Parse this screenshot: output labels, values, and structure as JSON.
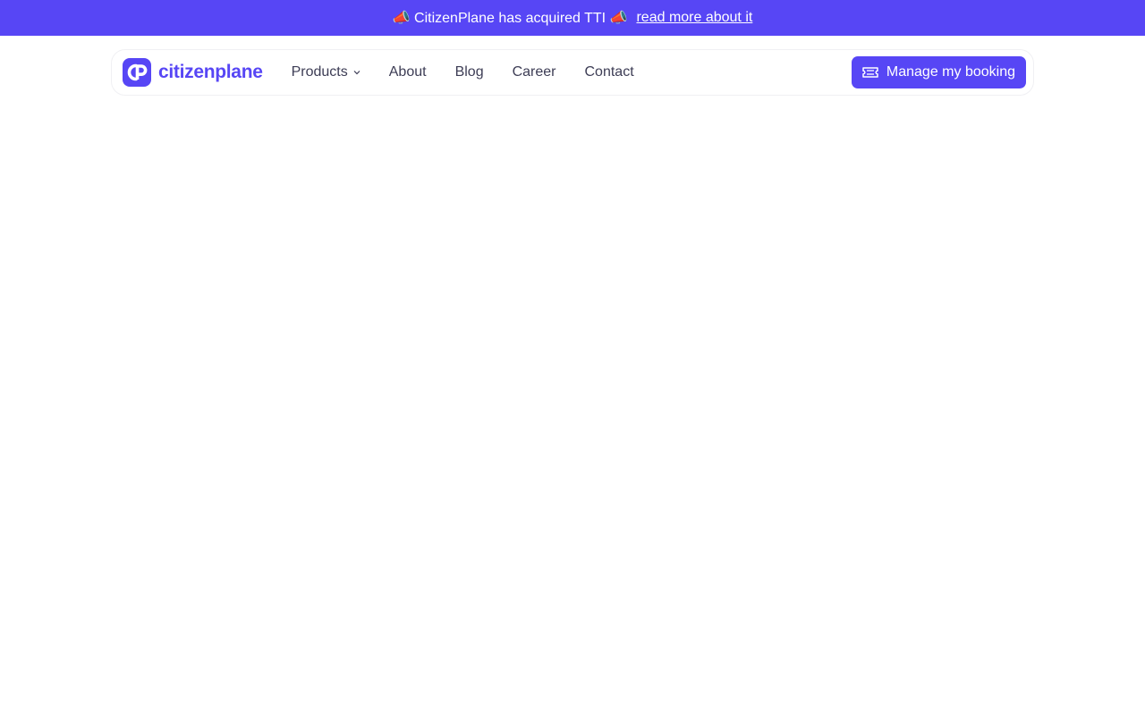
{
  "announcement": {
    "icon_left": "📣",
    "text": "CitizenPlane has acquired TTI",
    "icon_right": "📣",
    "link": "read more about it"
  },
  "brand": {
    "name": "citizenplane",
    "color": "#5746f5"
  },
  "nav": {
    "items": [
      {
        "label": "Products",
        "has_dropdown": true
      },
      {
        "label": "About"
      },
      {
        "label": "Blog"
      },
      {
        "label": "Career"
      },
      {
        "label": "Contact"
      }
    ],
    "cta": {
      "label": "Manage my booking",
      "icon": "ticket-icon"
    }
  }
}
